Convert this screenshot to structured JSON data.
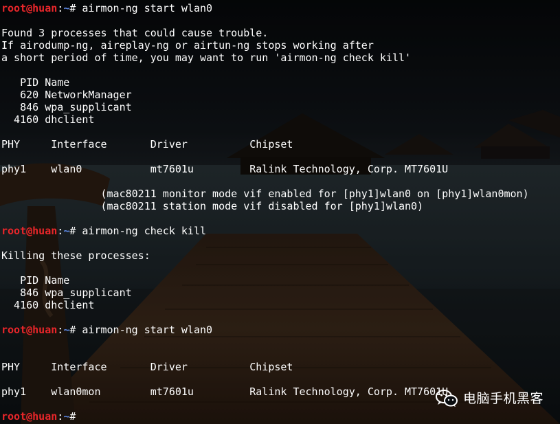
{
  "prompt": {
    "user": "root@huan",
    "sep": ":",
    "path": "~",
    "symbol": "# "
  },
  "lines": [
    {
      "kind": "prompt",
      "cmd": "airmon-ng start wlan0"
    },
    {
      "kind": "text",
      "text": ""
    },
    {
      "kind": "text",
      "text": "Found 3 processes that could cause trouble."
    },
    {
      "kind": "text",
      "text": "If airodump-ng, aireplay-ng or airtun-ng stops working after"
    },
    {
      "kind": "text",
      "text": "a short period of time, you may want to run 'airmon-ng check kill'"
    },
    {
      "kind": "text",
      "text": ""
    },
    {
      "kind": "text",
      "text": "   PID Name"
    },
    {
      "kind": "text",
      "text": "   620 NetworkManager"
    },
    {
      "kind": "text",
      "text": "   846 wpa_supplicant"
    },
    {
      "kind": "text",
      "text": "  4160 dhclient"
    },
    {
      "kind": "text",
      "text": ""
    },
    {
      "kind": "text",
      "text": "PHY     Interface       Driver          Chipset"
    },
    {
      "kind": "text",
      "text": ""
    },
    {
      "kind": "text",
      "text": "phy1    wlan0           mt7601u         Ralink Technology, Corp. MT7601U"
    },
    {
      "kind": "text",
      "text": ""
    },
    {
      "kind": "text",
      "text": "                (mac80211 monitor mode vif enabled for [phy1]wlan0 on [phy1]wlan0mon)"
    },
    {
      "kind": "text",
      "text": "                (mac80211 station mode vif disabled for [phy1]wlan0)"
    },
    {
      "kind": "text",
      "text": ""
    },
    {
      "kind": "prompt",
      "cmd": "airmon-ng check kill"
    },
    {
      "kind": "text",
      "text": ""
    },
    {
      "kind": "text",
      "text": "Killing these processes:"
    },
    {
      "kind": "text",
      "text": ""
    },
    {
      "kind": "text",
      "text": "   PID Name"
    },
    {
      "kind": "text",
      "text": "   846 wpa_supplicant"
    },
    {
      "kind": "text",
      "text": "  4160 dhclient"
    },
    {
      "kind": "text",
      "text": ""
    },
    {
      "kind": "prompt",
      "cmd": "airmon-ng start wlan0"
    },
    {
      "kind": "text",
      "text": ""
    },
    {
      "kind": "text",
      "text": ""
    },
    {
      "kind": "text",
      "text": "PHY     Interface       Driver          Chipset"
    },
    {
      "kind": "text",
      "text": ""
    },
    {
      "kind": "text",
      "text": "phy1    wlan0mon        mt7601u         Ralink Technology, Corp. MT7601U"
    },
    {
      "kind": "text",
      "text": ""
    },
    {
      "kind": "prompt",
      "cmd": ""
    }
  ],
  "watermark": {
    "text": "电脑手机黑客",
    "icon": "wechat-icon"
  },
  "colors": {
    "prompt_user": "#e8262a",
    "prompt_path": "#5b86e0",
    "text": "#ffffff",
    "watermark_icon": "#ffffff"
  }
}
